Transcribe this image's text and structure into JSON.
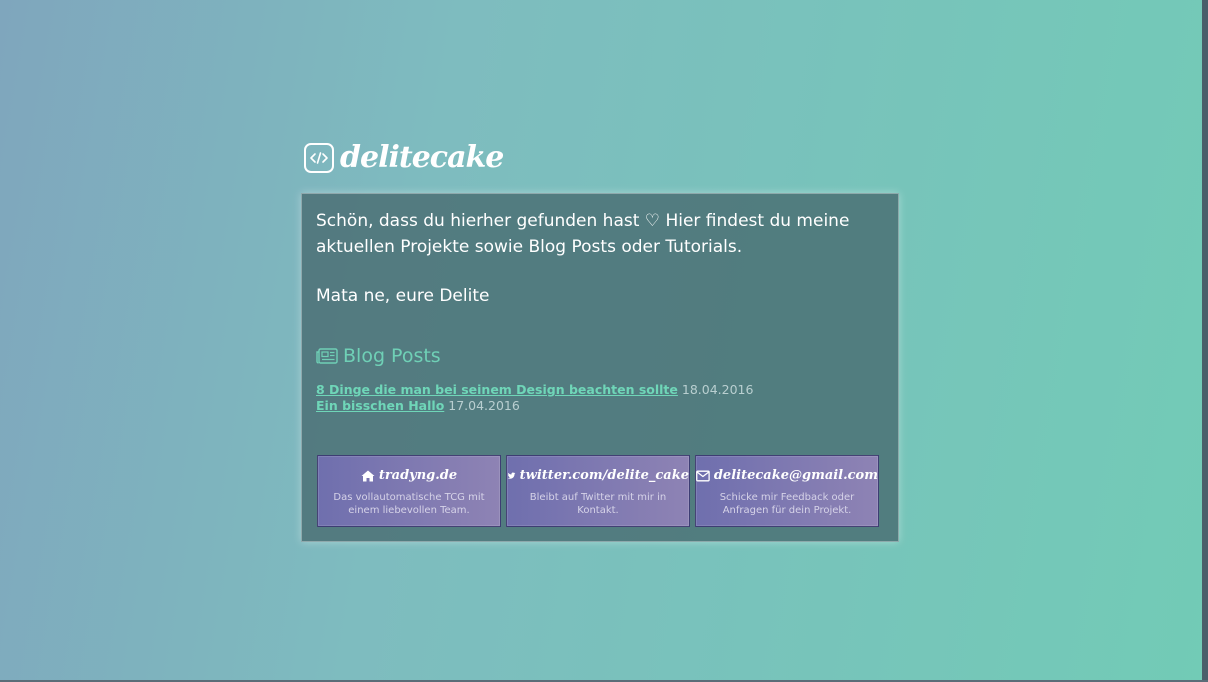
{
  "brand": {
    "name": "delitecake",
    "icon": "code-brackets-icon"
  },
  "intro": {
    "text": "Schön, dass du hierher gefunden hast ♡ Hier findest du meine aktuellen Projekte sowie Blog Posts oder Tutorials.",
    "signoff": "Mata ne, eure Delite"
  },
  "blog": {
    "heading": "Blog Posts",
    "icon": "newspaper-icon",
    "posts": [
      {
        "title": "8 Dinge die man bei seinem Design beachten sollte",
        "date": "18.04.2016"
      },
      {
        "title": "Ein bisschen Hallo",
        "date": "17.04.2016"
      }
    ]
  },
  "links": [
    {
      "label": "tradyng.de",
      "icon": "home-icon",
      "description": "Das vollautomatische TCG mit einem liebevollen Team."
    },
    {
      "label": "twitter.com/delite_cake",
      "icon": "twitter-icon",
      "description": "Bleibt auf Twitter mit mir in Kontakt."
    },
    {
      "label": "delitecake@gmail.com",
      "icon": "envelope-icon",
      "description": "Schicke mir Feedback oder Anfragen für dein Projekt."
    }
  ],
  "colors": {
    "accent": "#6fd0b6",
    "tile": "#7a76b0",
    "card": "#46696e"
  }
}
